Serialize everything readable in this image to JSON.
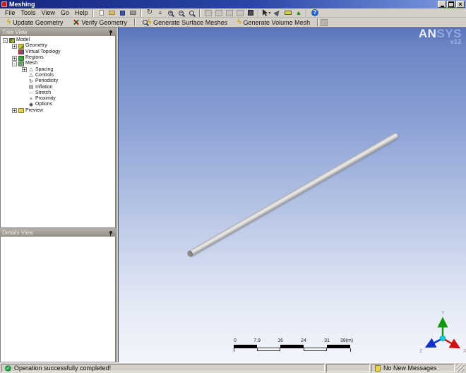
{
  "window": {
    "title": "Meshing"
  },
  "menu": [
    "File",
    "Tools",
    "View",
    "Go",
    "Help"
  ],
  "toolbar_main": {
    "icons": [
      "new",
      "open",
      "save",
      "print",
      "rotate",
      "pan",
      "zoom-in",
      "zoom-out",
      "zoom-box",
      "iso-view-1",
      "iso-view-2",
      "iso-view-3",
      "iso-view-4",
      "shaded-cube",
      "select-mode",
      "look-at",
      "legend",
      "triad-toggle",
      "help"
    ]
  },
  "mesh_toolbar": {
    "update_geometry": "Update Geometry",
    "verify_geometry": "Verify Geometry",
    "generate_surface": "Generate Surface Meshes",
    "generate_volume": "Generate Volume Mesh"
  },
  "tree_panel": {
    "title": "Tree View",
    "items": [
      {
        "label": "Model",
        "expander": "-",
        "depth": 0
      },
      {
        "label": "Geometry",
        "expander": "+",
        "depth": 1
      },
      {
        "label": "Virtual Topology",
        "expander": "",
        "depth": 1
      },
      {
        "label": "Regions",
        "expander": "+",
        "depth": 1
      },
      {
        "label": "Mesh",
        "expander": "-",
        "depth": 1
      },
      {
        "label": "Spacing",
        "expander": "+",
        "depth": 2
      },
      {
        "label": "Controls",
        "expander": "",
        "depth": 2
      },
      {
        "label": "Periodicity",
        "expander": "",
        "depth": 2
      },
      {
        "label": "Inflation",
        "expander": "",
        "depth": 2
      },
      {
        "label": "Stretch",
        "expander": "",
        "depth": 2
      },
      {
        "label": "Proximity",
        "expander": "",
        "depth": 2
      },
      {
        "label": "Options",
        "expander": "",
        "depth": 2
      },
      {
        "label": "Preview",
        "expander": "+",
        "depth": 1
      }
    ]
  },
  "details_panel": {
    "title": "Details View"
  },
  "viewport": {
    "logo": {
      "brand_strong": "AN",
      "brand_light": "SYS",
      "version": "v12"
    },
    "ruler": {
      "labels": [
        "0",
        "7.9",
        "16",
        "24",
        "31",
        "39(m)"
      ]
    },
    "triad": {
      "x_label": "X",
      "y_label": "Y",
      "z_label": "Z"
    }
  },
  "status_bar": {
    "message": "Operation successfully completed!",
    "messages": "No New Messages"
  },
  "colors": {
    "titlebar_left": "#16277e",
    "viewport_top": "#6d86c5",
    "viewport_bottom": "#f3f5fb",
    "triad_x": "#cc1111",
    "triad_y": "#119911",
    "triad_z": "#1133cc",
    "status_ok_green": "#22a04a",
    "lightning_yellow": "#c8a000"
  }
}
